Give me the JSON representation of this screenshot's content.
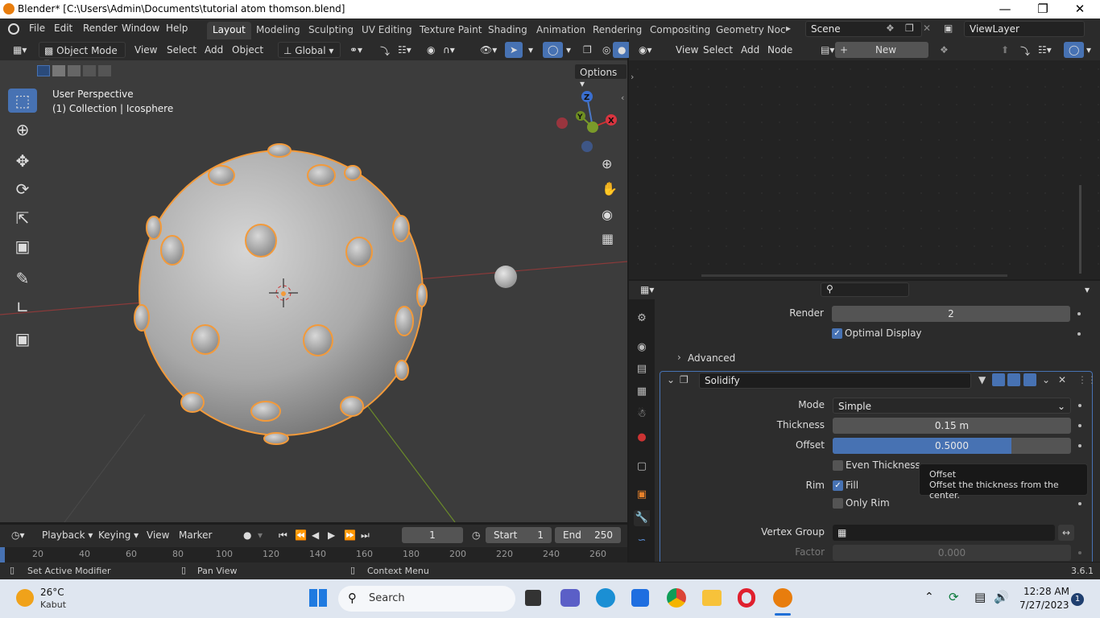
{
  "window": {
    "title": "Blender* [C:\\Users\\Admin\\Documents\\tutorial atom thomson.blend]",
    "min_icon": "minimize-icon",
    "max_icon": "maximize-icon",
    "close_icon": "close-icon"
  },
  "menu": [
    "File",
    "Edit",
    "Render",
    "Window",
    "Help"
  ],
  "workspaces": [
    "Layout",
    "Modeling",
    "Sculpting",
    "UV Editing",
    "Texture Paint",
    "Shading",
    "Animation",
    "Rendering",
    "Compositing",
    "Geometry Noc"
  ],
  "scene": {
    "label": "Scene",
    "view_layer": "ViewLayer"
  },
  "viewport_header": {
    "mode": "Object Mode",
    "view": "View",
    "select": "Select",
    "add": "Add",
    "object": "Object",
    "orientation": "Global",
    "options": "Options"
  },
  "viewport": {
    "perspective": "User Perspective",
    "collection": "(1) Collection | Icosphere",
    "axis_x": "X",
    "axis_y": "Y",
    "axis_z": "Z"
  },
  "node_header": {
    "view": "View",
    "select": "Select",
    "add": "Add",
    "node": "Node",
    "new": "New"
  },
  "properties": {
    "render_label": "Render",
    "render_value": "2",
    "optimal_display": "Optimal Display",
    "advanced": "Advanced",
    "modifier_name": "Solidify",
    "mode_label": "Mode",
    "mode_value": "Simple",
    "thickness_label": "Thickness",
    "thickness_value": "0.15 m",
    "offset_label": "Offset",
    "offset_value": "0.5000",
    "offset_fraction": 0.75,
    "even_thickness": "Even Thickness",
    "rim_label": "Rim",
    "fill": "Fill",
    "only_rim": "Only Rim",
    "vertex_group_label": "Vertex Group",
    "factor_label": "Factor",
    "factor_value": "0.000"
  },
  "tooltip": {
    "title": "Offset",
    "text": "Offset the thickness from the center."
  },
  "timeline": {
    "playback": "Playback",
    "keying": "Keying",
    "view": "View",
    "marker": "Marker",
    "current_frame": "1",
    "start_label": "Start",
    "start_value": "1",
    "end_label": "End",
    "end_value": "250",
    "ticks": [
      "20",
      "40",
      "60",
      "80",
      "100",
      "120",
      "140",
      "160",
      "180",
      "200",
      "220",
      "240",
      "260"
    ]
  },
  "status": {
    "left": "Set Active Modifier",
    "mid": "Pan View",
    "right": "Context Menu",
    "version": "3.6.1"
  },
  "taskbar": {
    "weather_temp": "26°C",
    "weather_desc": "Kabut",
    "search": "Search",
    "time": "12:28 AM",
    "date": "7/27/2023",
    "notif": "1"
  }
}
